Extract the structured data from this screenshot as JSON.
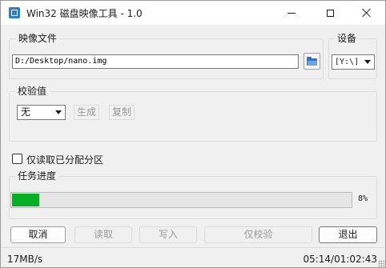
{
  "window": {
    "title": "Win32 磁盘映像工具 - 1.0"
  },
  "image_group": {
    "label": "映像文件",
    "file_path": "D:/Desktop/nano.img",
    "browse_icon": "folder-icon"
  },
  "device_group": {
    "label": "设备",
    "selected": "[Y:\\]"
  },
  "hash_group": {
    "label": "校验值",
    "selected": "无",
    "generate_label": "生成",
    "copy_label": "复制"
  },
  "read_only": {
    "label": "仅读取已分配分区",
    "checked": false
  },
  "progress_group": {
    "label": "任务进度",
    "percent": 8,
    "percent_text": "8%",
    "fill_color": "#06b025"
  },
  "buttons": {
    "cancel": "取消",
    "read": "读取",
    "write": "写入",
    "verify": "仅校验",
    "exit": "退出"
  },
  "status": {
    "speed": "17MB/s",
    "time": "05:14/01:02:43"
  }
}
